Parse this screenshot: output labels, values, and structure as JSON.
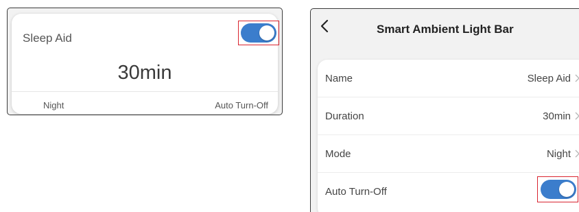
{
  "widget": {
    "title": "Sleep Aid",
    "duration": "30min",
    "mode": "Night",
    "auto_label": "Auto Turn-Off",
    "toggle_on": true
  },
  "app": {
    "title": "Smart Ambient Light Bar",
    "rows": [
      {
        "label": "Name",
        "value": "Sleep Aid"
      },
      {
        "label": "Duration",
        "value": "30min"
      },
      {
        "label": "Mode",
        "value": "Night"
      },
      {
        "label": "Auto Turn-Off",
        "value": ""
      }
    ],
    "auto_turn_off_on": true
  },
  "colors": {
    "accent": "#3b7dcc",
    "highlight": "#d9232e"
  }
}
